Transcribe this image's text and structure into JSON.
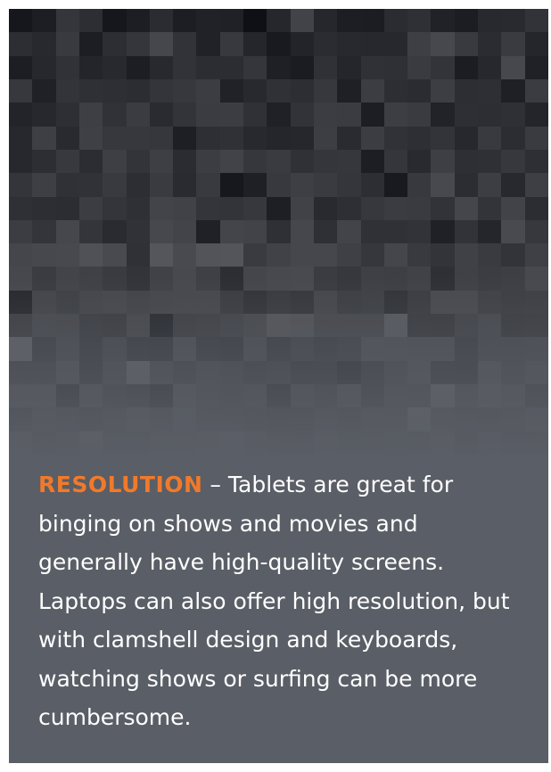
{
  "card": {
    "heading": "RESOLUTION",
    "separator": " – ",
    "body": "Tablets are great for binging on shows and movies and generally have high-quality screens. Laptops can also offer high resolution, but with clamshell design and keyboards, watching shows or surfing can be more cumbersome.",
    "accent_color": "#f07a2a",
    "background_color": "#5a5e66"
  },
  "background": {
    "description_icon": "pixelated-mosaic-image"
  }
}
